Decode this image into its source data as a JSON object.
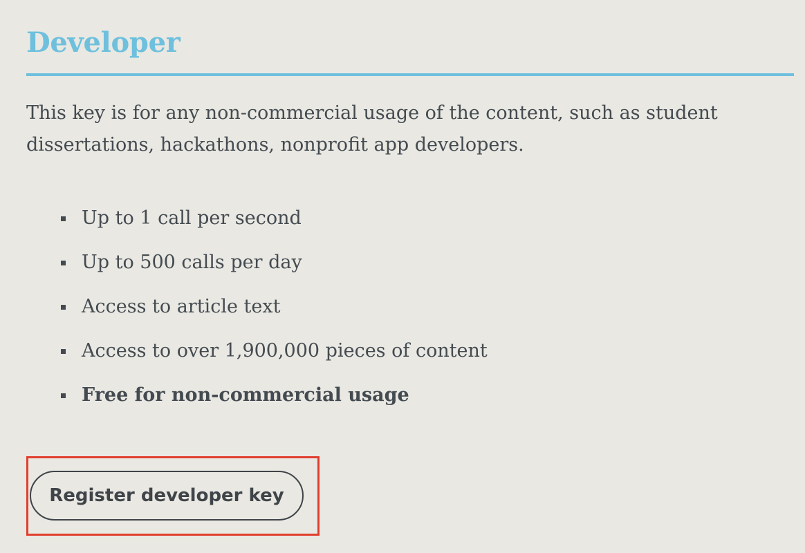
{
  "section": {
    "title": "Developer",
    "description": "This key is for any non-commercial usage of the content, such as student dissertations, hackathons, nonprofit app developers."
  },
  "features": [
    {
      "text": "Up to 1 call per second",
      "bold": false
    },
    {
      "text": "Up to 500 calls per day",
      "bold": false
    },
    {
      "text": "Access to article text",
      "bold": false
    },
    {
      "text": "Access to over 1,900,000 pieces of content",
      "bold": false
    },
    {
      "text": "Free for non-commercial usage",
      "bold": true
    }
  ],
  "actions": {
    "register_label": "Register developer key"
  },
  "colors": {
    "accent": "#6ec0dd",
    "text": "#444b50",
    "background": "#e9e8e3",
    "highlight": "#e03e2d"
  }
}
